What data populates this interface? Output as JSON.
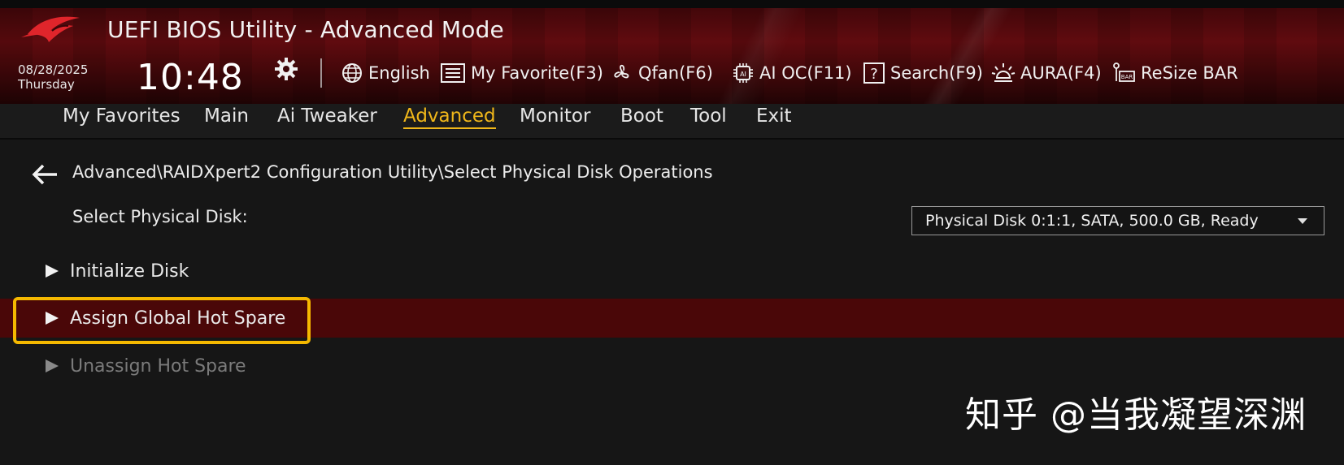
{
  "app": {
    "title": "UEFI BIOS Utility - Advanced Mode",
    "date": "08/28/2025",
    "day": "Thursday",
    "time": "10:48"
  },
  "toolbar": {
    "language": "English",
    "favorite": "My Favorite(F3)",
    "qfan": "Qfan(F6)",
    "aioc": "AI OC(F11)",
    "search": "Search(F9)",
    "aura": "AURA(F4)",
    "resizebar": "ReSize BAR"
  },
  "menu": {
    "items": [
      "My Favorites",
      "Main",
      "Ai Tweaker",
      "Advanced",
      "Monitor",
      "Boot",
      "Tool",
      "Exit"
    ],
    "active": "Advanced"
  },
  "breadcrumb": "Advanced\\RAIDXpert2 Configuration Utility\\Select Physical Disk Operations",
  "select_physical_disk": {
    "label": "Select Physical Disk:",
    "value": "Physical Disk 0:1:1, SATA, 500.0 GB, Ready"
  },
  "entries": [
    {
      "label": "Initialize Disk",
      "state": "normal"
    },
    {
      "label": "Assign Global Hot Spare",
      "state": "selected"
    },
    {
      "label": "Unassign Hot Spare",
      "state": "disabled"
    }
  ],
  "watermark": "知乎 @当我凝望深渊",
  "colors": {
    "accent": "#f0b71a",
    "highlight_row": "#4a0708",
    "callout_frame": "#f5b800",
    "header_red": "#5e0a0e"
  }
}
